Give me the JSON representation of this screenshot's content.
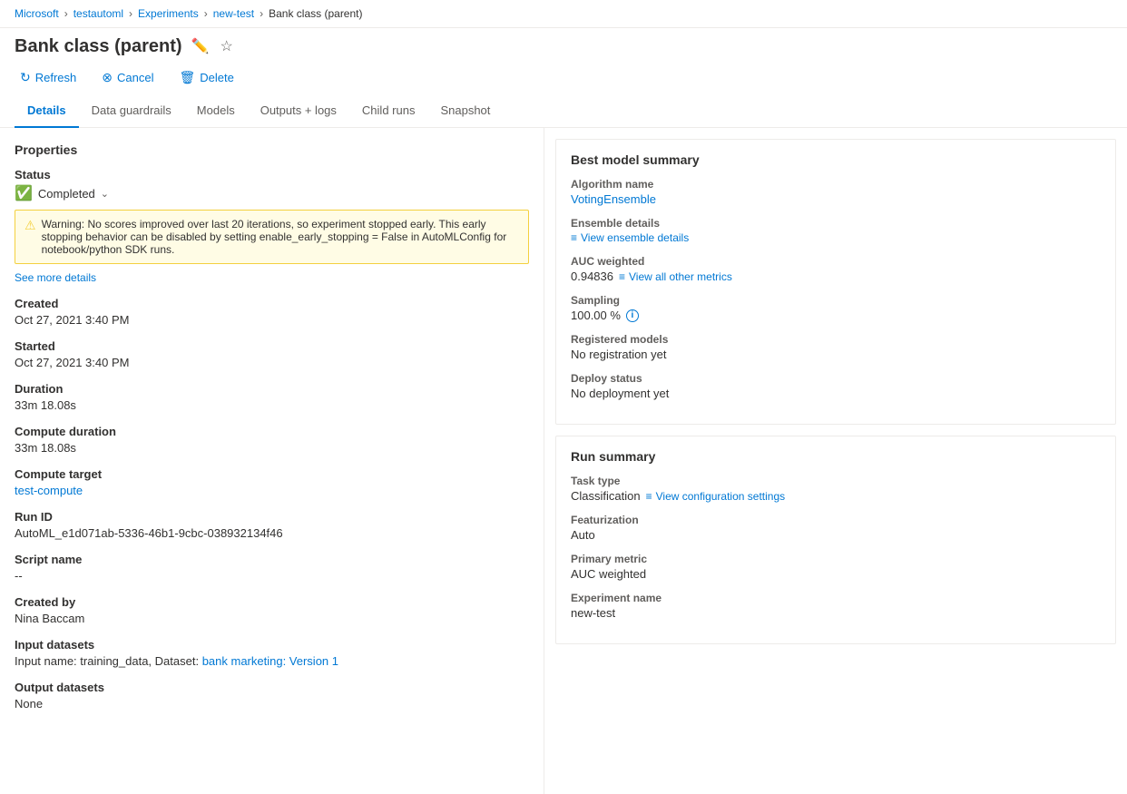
{
  "breadcrumb": {
    "items": [
      {
        "label": "Microsoft",
        "href": "#"
      },
      {
        "label": "testautoml",
        "href": "#"
      },
      {
        "label": "Experiments",
        "href": "#"
      },
      {
        "label": "new-test",
        "href": "#"
      },
      {
        "label": "Bank class (parent)",
        "current": true
      }
    ]
  },
  "title": "Bank class (parent)",
  "toolbar": {
    "refresh_label": "Refresh",
    "cancel_label": "Cancel",
    "delete_label": "Delete"
  },
  "tabs": [
    {
      "label": "Details",
      "active": true
    },
    {
      "label": "Data guardrails"
    },
    {
      "label": "Models"
    },
    {
      "label": "Outputs + logs"
    },
    {
      "label": "Child runs"
    },
    {
      "label": "Snapshot"
    }
  ],
  "properties": {
    "section_title": "Properties",
    "status_label": "Status",
    "status_value": "Completed",
    "warning_text": "Warning: No scores improved over last 20 iterations, so experiment stopped early. This early stopping behavior can be disabled by setting enable_early_stopping = False in AutoMLConfig for notebook/python SDK runs.",
    "see_more_label": "See more details",
    "created_label": "Created",
    "created_value": "Oct 27, 2021 3:40 PM",
    "started_label": "Started",
    "started_value": "Oct 27, 2021 3:40 PM",
    "duration_label": "Duration",
    "duration_value": "33m 18.08s",
    "compute_duration_label": "Compute duration",
    "compute_duration_value": "33m 18.08s",
    "compute_target_label": "Compute target",
    "compute_target_value": "test-compute",
    "run_id_label": "Run ID",
    "run_id_value": "AutoML_e1d071ab-5336-46b1-9cbc-038932134f46",
    "script_name_label": "Script name",
    "script_name_value": "--",
    "created_by_label": "Created by",
    "created_by_value": "Nina Baccam",
    "input_datasets_label": "Input datasets",
    "input_datasets_text": "Input name: training_data, Dataset: ",
    "input_datasets_link": "bank marketing: Version 1",
    "output_datasets_label": "Output datasets",
    "output_datasets_value": "None"
  },
  "best_model": {
    "section_title": "Best model summary",
    "algorithm_label": "Algorithm name",
    "algorithm_value": "VotingEnsemble",
    "ensemble_label": "Ensemble details",
    "ensemble_link": "View ensemble details",
    "auc_label": "AUC weighted",
    "auc_value": "0.94836",
    "auc_metrics_link": "View all other metrics",
    "sampling_label": "Sampling",
    "sampling_value": "100.00 %",
    "registered_models_label": "Registered models",
    "registered_models_value": "No registration yet",
    "deploy_status_label": "Deploy status",
    "deploy_status_value": "No deployment yet"
  },
  "run_summary": {
    "section_title": "Run summary",
    "task_type_label": "Task type",
    "task_type_value": "Classification",
    "config_settings_link": "View configuration settings",
    "featurization_label": "Featurization",
    "featurization_value": "Auto",
    "primary_metric_label": "Primary metric",
    "primary_metric_value": "AUC weighted",
    "experiment_name_label": "Experiment name",
    "experiment_name_value": "new-test"
  }
}
